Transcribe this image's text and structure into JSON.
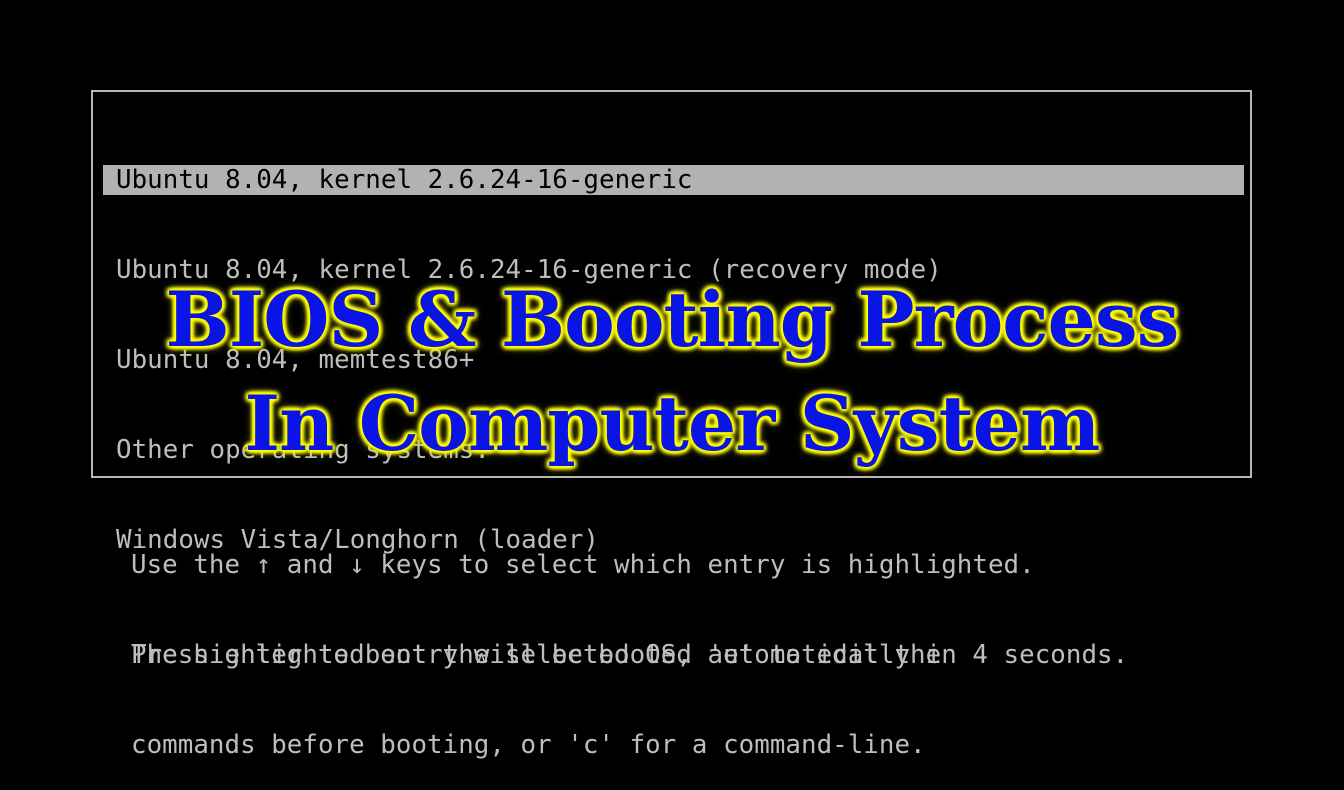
{
  "boot_menu": {
    "entries": [
      {
        "label": "Ubuntu 8.04, kernel 2.6.24-16-generic",
        "selected": true
      },
      {
        "label": "Ubuntu 8.04, kernel 2.6.24-16-generic (recovery mode)",
        "selected": false
      },
      {
        "label": "Ubuntu 8.04, memtest86+",
        "selected": false
      },
      {
        "label": "Other operating systems:",
        "selected": false
      },
      {
        "label": "Windows Vista/Longhorn (loader)",
        "selected": false
      }
    ]
  },
  "overlay_title": {
    "line1": "BIOS & Booting Process",
    "line2": "In Computer System",
    "text_color": "#0a14e6",
    "glow_color": "#ffff00"
  },
  "help_text": {
    "line1": "Use the ↑ and ↓ keys to select which entry is highlighted.",
    "line2": "Press enter to boot the selected OS, 'e' to edit the",
    "line3": "commands before booting, or 'c' for a command-line."
  },
  "countdown": {
    "text": "The highlighted entry will be booted automatically in 4 seconds.",
    "seconds_remaining": 4
  },
  "colors": {
    "background": "#000000",
    "text": "#bdbdbd",
    "highlight_bar": "#b2b2b2",
    "highlight_text": "#000000",
    "border": "#b8b8b8"
  }
}
